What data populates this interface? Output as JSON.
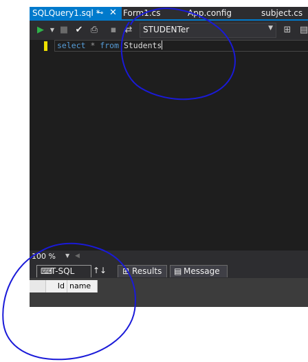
{
  "tabs": [
    {
      "label": "SQLQuery1.sql *",
      "pin": "⊸",
      "close": "✕",
      "active": true
    },
    {
      "label": "Form1.cs",
      "active": false
    },
    {
      "label": "App.config",
      "active": false
    },
    {
      "label": "subject.cs",
      "active": false
    }
  ],
  "toolbar": {
    "database": "STUDENTer",
    "icons": [
      "execute-icon",
      "dropdown-arrow-icon",
      "stop-icon",
      "parse-checkmark-icon",
      "display-plan-icon",
      "connect-icon",
      "change-connection-icon",
      "results-to-icon",
      "toolbar-overflow-icon"
    ]
  },
  "editor": {
    "code": {
      "kw1": "select",
      "star": " * ",
      "kw2": "from",
      "table": " Students"
    }
  },
  "status": {
    "zoom": "100 %"
  },
  "bottom_tabs": {
    "tsql": "T-SQL",
    "sort": "↑↓",
    "results": "Results",
    "messages": "Message"
  },
  "results": {
    "columns": [
      "Id",
      "name"
    ]
  },
  "colors": {
    "accent": "#007acc",
    "annotation": "#1a1ad8",
    "keyword": "#569cd6"
  }
}
